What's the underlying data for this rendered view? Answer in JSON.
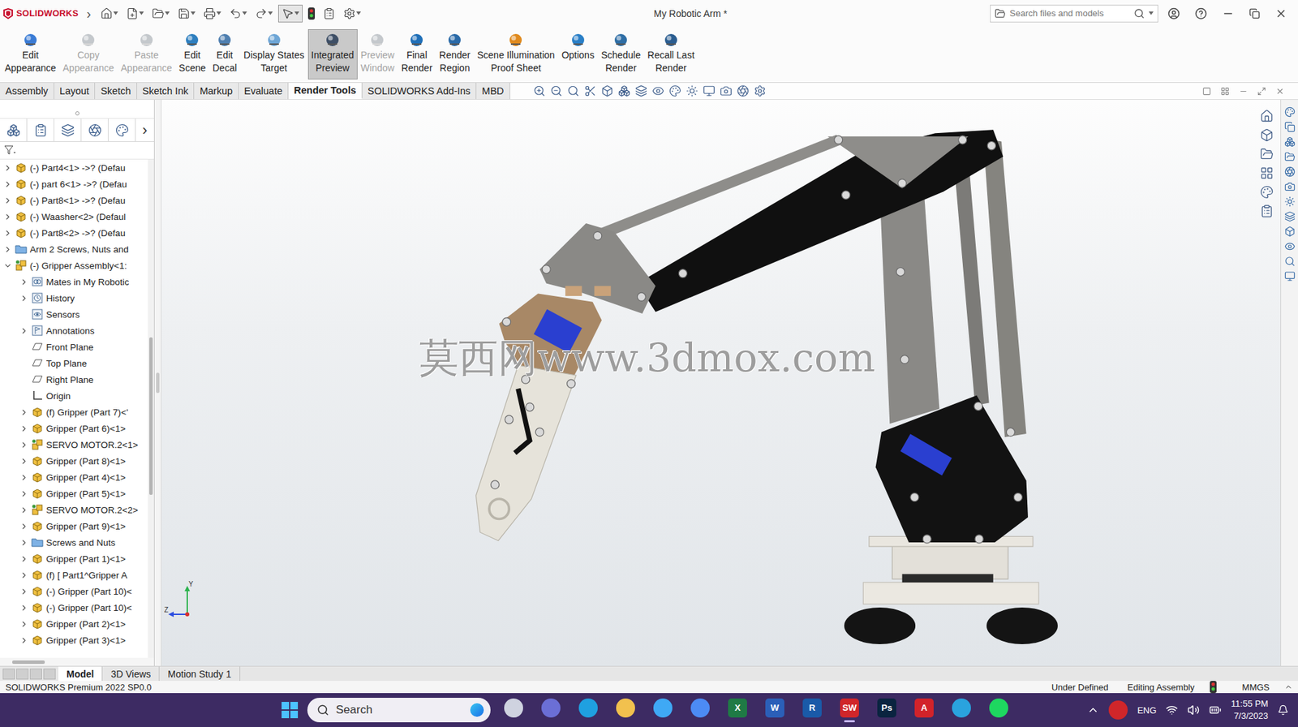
{
  "window": {
    "app": "SOLIDWORKS",
    "menu_glyph": "›",
    "title": "My Robotic Arm *"
  },
  "search": {
    "placeholder": "Search files and models"
  },
  "ribbon": [
    {
      "lines": [
        "Edit",
        "Appearance"
      ],
      "disabled": false,
      "selected": false
    },
    {
      "lines": [
        "Copy",
        "Appearance"
      ],
      "disabled": true,
      "selected": false
    },
    {
      "lines": [
        "Paste",
        "Appearance"
      ],
      "disabled": true,
      "selected": false
    },
    {
      "lines": [
        "Edit",
        "Scene"
      ],
      "disabled": false,
      "selected": false
    },
    {
      "lines": [
        "Edit",
        "Decal"
      ],
      "disabled": false,
      "selected": false
    },
    {
      "lines": [
        "Display States",
        "Target"
      ],
      "disabled": false,
      "selected": false
    },
    {
      "lines": [
        "Integrated",
        "Preview"
      ],
      "disabled": false,
      "selected": true
    },
    {
      "lines": [
        "Preview",
        "Window"
      ],
      "disabled": true,
      "selected": false
    },
    {
      "lines": [
        "Final",
        "Render"
      ],
      "disabled": false,
      "selected": false
    },
    {
      "lines": [
        "Render",
        "Region"
      ],
      "disabled": false,
      "selected": false
    },
    {
      "lines": [
        "Scene Illumination",
        "Proof Sheet"
      ],
      "disabled": false,
      "selected": false
    },
    {
      "lines": [
        "Options"
      ],
      "disabled": false,
      "selected": false
    },
    {
      "lines": [
        "Schedule",
        "Render"
      ],
      "disabled": false,
      "selected": false
    },
    {
      "lines": [
        "Recall Last",
        "Render"
      ],
      "disabled": false,
      "selected": false
    }
  ],
  "command_tabs": [
    {
      "label": "Assembly",
      "selected": false
    },
    {
      "label": "Layout",
      "selected": false
    },
    {
      "label": "Sketch",
      "selected": false
    },
    {
      "label": "Sketch Ink",
      "selected": false
    },
    {
      "label": "Markup",
      "selected": false
    },
    {
      "label": "Evaluate",
      "selected": false
    },
    {
      "label": "Render Tools",
      "selected": true
    },
    {
      "label": "SOLIDWORKS Add-Ins",
      "selected": false
    },
    {
      "label": "MBD",
      "selected": false
    }
  ],
  "tree": {
    "more_glyph": "›",
    "items": [
      {
        "label": "(-) Part4<1> ->? (Defau",
        "level": 0,
        "icon": "part",
        "arrow": true,
        "expanded": false
      },
      {
        "label": "(-) part 6<1> ->? (Defau",
        "level": 0,
        "icon": "part",
        "arrow": true,
        "expanded": false
      },
      {
        "label": "(-) Part8<1> ->? (Defau",
        "level": 0,
        "icon": "part",
        "arrow": true,
        "expanded": false
      },
      {
        "label": "(-) Waasher<2> (Defaul",
        "level": 0,
        "icon": "part",
        "arrow": true,
        "expanded": false
      },
      {
        "label": "(-) Part8<2> ->? (Defau",
        "level": 0,
        "icon": "part",
        "arrow": true,
        "expanded": false
      },
      {
        "label": "Arm 2 Screws, Nuts and",
        "level": 0,
        "icon": "folder",
        "arrow": true,
        "expanded": false
      },
      {
        "label": "(-) Gripper Assembly<1:",
        "level": 0,
        "icon": "assembly",
        "arrow": true,
        "expanded": true
      },
      {
        "label": "Mates in My Robotic",
        "level": 1,
        "icon": "mates",
        "arrow": true,
        "expanded": false
      },
      {
        "label": "History",
        "level": 1,
        "icon": "history",
        "arrow": true,
        "expanded": false
      },
      {
        "label": "Sensors",
        "level": 1,
        "icon": "sensors",
        "arrow": false,
        "expanded": false
      },
      {
        "label": "Annotations",
        "level": 1,
        "icon": "annotations",
        "arrow": true,
        "expanded": false
      },
      {
        "label": "Front Plane",
        "level": 1,
        "icon": "plane",
        "arrow": false,
        "expanded": false
      },
      {
        "label": "Top Plane",
        "level": 1,
        "icon": "plane",
        "arrow": false,
        "expanded": false
      },
      {
        "label": "Right Plane",
        "level": 1,
        "icon": "plane",
        "arrow": false,
        "expanded": false
      },
      {
        "label": "Origin",
        "level": 1,
        "icon": "origin",
        "arrow": false,
        "expanded": false
      },
      {
        "label": "(f) Gripper (Part 7)<'",
        "level": 1,
        "icon": "part",
        "arrow": true,
        "expanded": false
      },
      {
        "label": "Gripper (Part 6)<1>",
        "level": 1,
        "icon": "part",
        "arrow": true,
        "expanded": false
      },
      {
        "label": "SERVO MOTOR.2<1>",
        "level": 1,
        "icon": "assembly",
        "arrow": true,
        "expanded": false
      },
      {
        "label": "Gripper (Part 8)<1>",
        "level": 1,
        "icon": "part",
        "arrow": true,
        "expanded": false
      },
      {
        "label": "Gripper (Part 4)<1>",
        "level": 1,
        "icon": "part",
        "arrow": true,
        "expanded": false
      },
      {
        "label": "Gripper (Part 5)<1>",
        "level": 1,
        "icon": "part",
        "arrow": true,
        "expanded": false
      },
      {
        "label": "SERVO MOTOR.2<2>",
        "level": 1,
        "icon": "assembly",
        "arrow": true,
        "expanded": false
      },
      {
        "label": "Gripper (Part 9)<1>",
        "level": 1,
        "icon": "part",
        "arrow": true,
        "expanded": false
      },
      {
        "label": "Screws and Nuts",
        "level": 1,
        "icon": "folder",
        "arrow": true,
        "expanded": false
      },
      {
        "label": "Gripper (Part 1)<1>",
        "level": 1,
        "icon": "part",
        "arrow": true,
        "expanded": false
      },
      {
        "label": "(f) [ Part1^Gripper A",
        "level": 1,
        "icon": "part",
        "arrow": true,
        "expanded": false
      },
      {
        "label": "(-) Gripper (Part 10)<",
        "level": 1,
        "icon": "part",
        "arrow": true,
        "expanded": false
      },
      {
        "label": "(-) Gripper (Part 10)<",
        "level": 1,
        "icon": "part",
        "arrow": true,
        "expanded": false
      },
      {
        "label": "Gripper (Part 2)<1>",
        "level": 1,
        "icon": "part",
        "arrow": true,
        "expanded": false
      },
      {
        "label": "Gripper (Part 3)<1>",
        "level": 1,
        "icon": "part",
        "arrow": true,
        "expanded": false
      }
    ]
  },
  "viewport": {
    "watermark": "莫西网www.3dmox.com",
    "axes": [
      "Y",
      "Z"
    ]
  },
  "bottom_tabs": [
    {
      "label": "Model",
      "selected": true
    },
    {
      "label": "3D Views",
      "selected": false
    },
    {
      "label": "Motion Study 1",
      "selected": false
    }
  ],
  "status_bar": {
    "product": "SOLIDWORKS Premium 2022 SP0.0",
    "state": "Under Defined",
    "mode": "Editing Assembly",
    "units": "MMGS"
  },
  "taskbar": {
    "search": "Search",
    "apps": [
      {
        "label": "",
        "color": "#cfd3e0",
        "active": false
      },
      {
        "label": "",
        "color": "#6b6fd6",
        "active": false
      },
      {
        "label": "",
        "color": "#1fa0e0",
        "active": false
      },
      {
        "label": "",
        "color": "#f2c14e",
        "active": false
      },
      {
        "label": "",
        "color": "#3fa9f5",
        "active": false
      },
      {
        "label": "",
        "color": "#4c8bf5",
        "active": false
      },
      {
        "label": "X",
        "color": "#1f7a45",
        "active": false
      },
      {
        "label": "W",
        "color": "#2b5fb8",
        "active": false
      },
      {
        "label": "R",
        "color": "#1a5aa8",
        "active": false
      },
      {
        "label": "SW",
        "color": "#d0262a",
        "active": true
      },
      {
        "label": "Ps",
        "color": "#0a2440",
        "active": false
      },
      {
        "label": "A",
        "color": "#d2232a",
        "active": false
      },
      {
        "label": "",
        "color": "#2aa3de",
        "active": false
      },
      {
        "label": "",
        "color": "#1ed760",
        "active": false
      }
    ],
    "language": "ENG",
    "time": "11:55 PM",
    "date": "7/3/2023"
  }
}
